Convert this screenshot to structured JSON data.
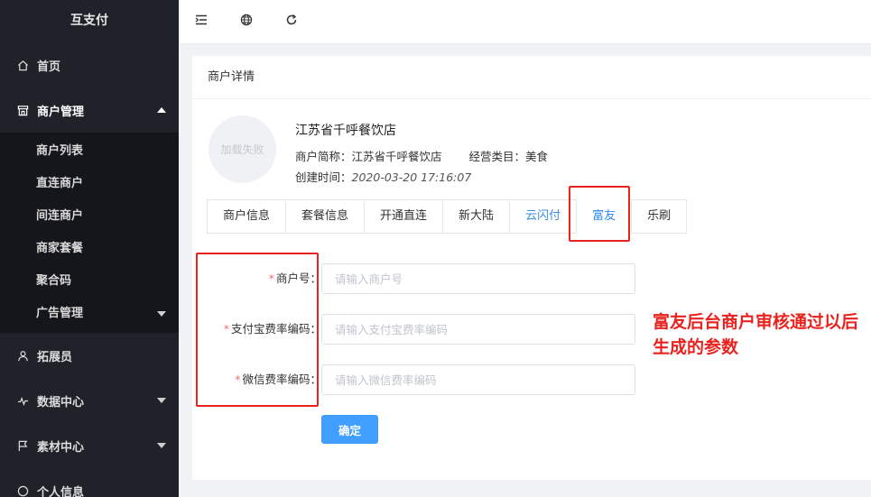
{
  "app": {
    "title": "互支付"
  },
  "sidebar": {
    "items": [
      {
        "label": "首页",
        "icon": "home-icon"
      },
      {
        "label": "商户管理",
        "icon": "merchant-icon",
        "open": true
      },
      {
        "label": "拓展员",
        "icon": "user-icon"
      },
      {
        "label": "数据中心",
        "icon": "chart-icon"
      },
      {
        "label": "素材中心",
        "icon": "flag-icon"
      },
      {
        "label": "个人信息",
        "icon": "profile-icon"
      }
    ],
    "submenu": [
      {
        "label": "商户列表"
      },
      {
        "label": "直连商户"
      },
      {
        "label": "间连商户"
      },
      {
        "label": "商家套餐"
      },
      {
        "label": "聚合码"
      },
      {
        "label": "广告管理"
      }
    ]
  },
  "topbar": {
    "icons": [
      "collapse-menu-icon",
      "globe-icon",
      "refresh-icon"
    ]
  },
  "card": {
    "title": "商户详情",
    "avatar_text": "加载失败",
    "merchant_name": "江苏省千呼餐饮店",
    "short_name_label": "商户简称：",
    "short_name": "江苏省千呼餐饮店",
    "category_label": "经营类目：",
    "category": "美食",
    "created_label": "创建时间：",
    "created_at": "2020-03-20 17:16:07"
  },
  "tabs": [
    {
      "label": "商户信息"
    },
    {
      "label": "套餐信息"
    },
    {
      "label": "开通直连"
    },
    {
      "label": "新大陆"
    },
    {
      "label": "云闪付"
    },
    {
      "label": "富友"
    },
    {
      "label": "乐刷"
    }
  ],
  "form": {
    "fields": [
      {
        "label": "商户号：",
        "placeholder": "请输入商户号",
        "value": ""
      },
      {
        "label": "支付宝费率编码：",
        "placeholder": "请输入支付宝费率编码",
        "value": ""
      },
      {
        "label": "微信费率编码：",
        "placeholder": "请输入微信费率编码",
        "value": ""
      }
    ],
    "submit_label": "确定"
  },
  "annotation": {
    "text": "富友后台商户审核通过以后生成的参数"
  },
  "colors": {
    "sidebar_bg": "#20222a",
    "submenu_bg": "#15161b",
    "accent": "#409eff",
    "annotation": "#e8231f"
  }
}
